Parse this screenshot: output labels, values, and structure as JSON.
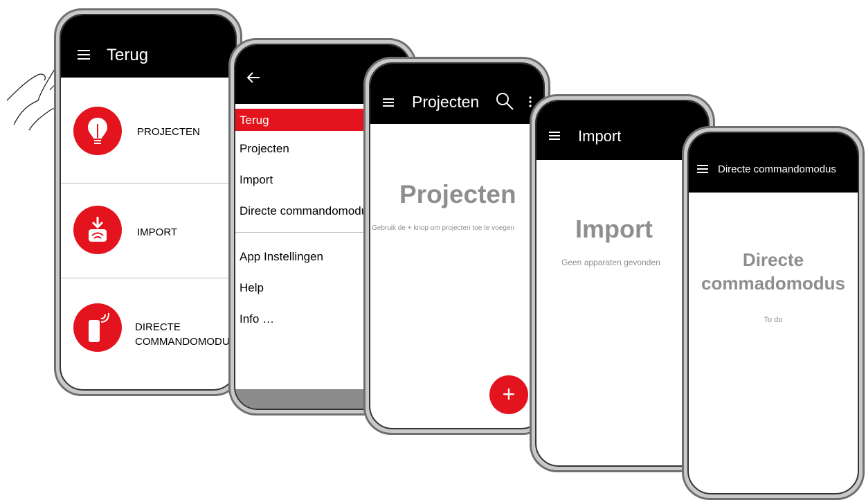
{
  "screen1": {
    "title": "Terug",
    "items": [
      {
        "label": "PROJECTEN"
      },
      {
        "label": "IMPORT"
      },
      {
        "label": "DIRECTE",
        "label2": "COMMANDOMODUS"
      }
    ]
  },
  "screen2": {
    "menu": [
      "Terug",
      "Projecten",
      "Import",
      "Directe commandomodus"
    ],
    "menu2": [
      "App Instellingen",
      "Help",
      "Info …"
    ]
  },
  "screen3": {
    "title": "Projecten",
    "heading": "Projecten",
    "hint": "Gebruik de + knop om projecten toe te voegen",
    "fab": "+"
  },
  "screen4": {
    "title": "Import",
    "heading": "Import",
    "message": "Geen apparaten gevonden"
  },
  "screen5": {
    "title": "Directe commandomodus",
    "heading_line1": "Directe",
    "heading_line2": "commadomodus",
    "message": "To do"
  },
  "colors": {
    "accent": "#e3141d",
    "bar": "#000000",
    "muted": "#8e8e8e"
  }
}
